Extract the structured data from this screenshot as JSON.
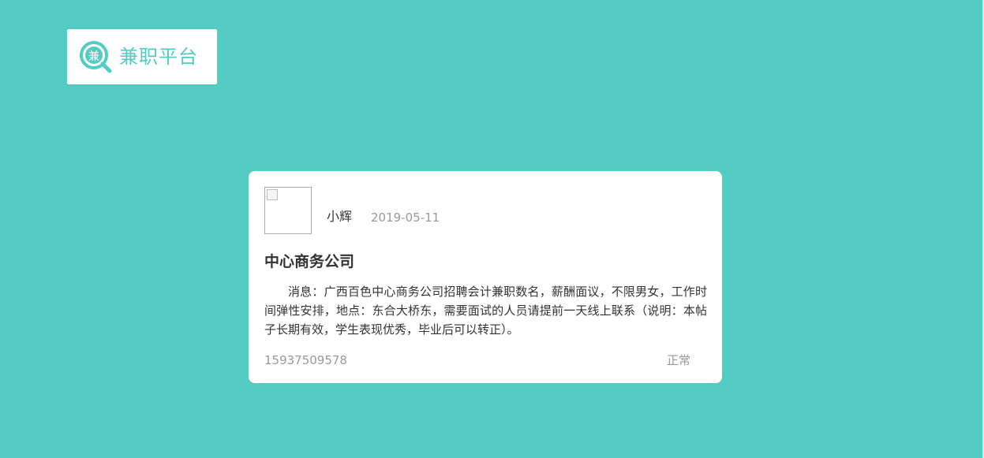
{
  "brand": {
    "logo_glyph": "兼",
    "name": "兼职平台",
    "color": "#53ccc4"
  },
  "colors": {
    "background": "#53ccc4",
    "card": "#ffffff",
    "text_primary": "#333333",
    "text_muted": "#999999"
  },
  "post": {
    "avatar_icon": "broken-image-icon",
    "poster_name": "小辉",
    "date": "2019-05-11",
    "title": "中心商务公司",
    "body": "消息：广西百色中心商务公司招聘会计兼职数名，薪酬面议，不限男女，工作时间弹性安排，地点：东合大桥东，需要面试的人员请提前一天线上联系（说明：本帖子长期有效，学生表现优秀，毕业后可以转正）。",
    "phone": "15937509578",
    "status": "正常"
  }
}
